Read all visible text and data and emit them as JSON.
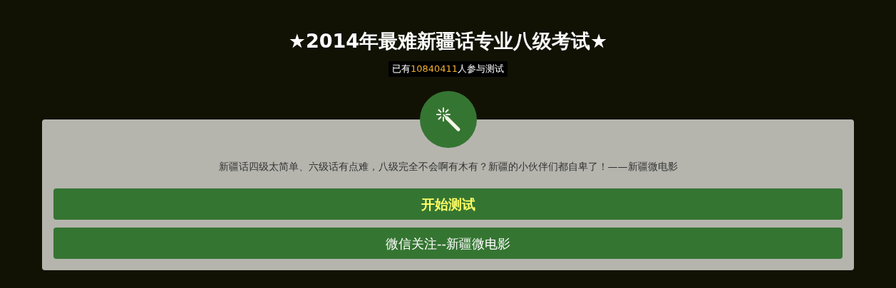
{
  "title": "★2014年最难新疆话专业八级考试★",
  "counter": {
    "prefix": "已有",
    "count": "10840411",
    "suffix": "人参与测试"
  },
  "description": "新疆话四级太简单、六级话有点难，八级完全不会啊有木有？新疆的小伙伴们都自卑了！——新疆微电影",
  "buttons": [
    {
      "label": "开始测试",
      "kind": "primary"
    },
    {
      "label": "微信关注--新疆微电影",
      "kind": "secondary"
    }
  ]
}
